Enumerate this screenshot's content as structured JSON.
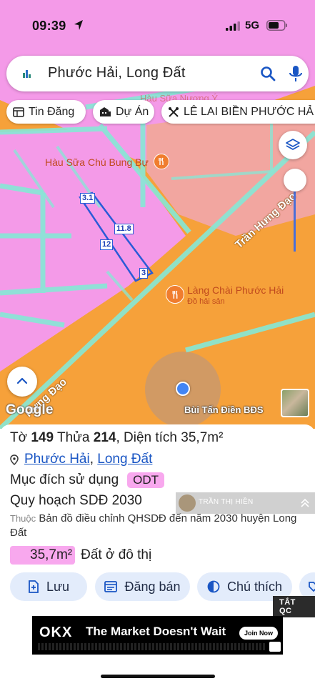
{
  "status_bar": {
    "time": "09:39",
    "network": "5G"
  },
  "search": {
    "query": "Phước Hải, Long Đất"
  },
  "chips": [
    {
      "label": "Tin Đăng",
      "icon": "newspaper-icon"
    },
    {
      "label": "Dự Án",
      "icon": "buildings-icon"
    },
    {
      "label": "LÊ LAI BIỀN PHƯỚC HẢ",
      "icon": "tools-icon"
    }
  ],
  "map": {
    "pois": [
      {
        "name": "Hàu Sữa Chú Bung Bự",
        "icon": "restaurant-icon"
      },
      {
        "name": "Làng Chài Phước Hải",
        "subtitle": "Đồ hải sản",
        "icon": "restaurant-icon"
      }
    ],
    "faded_poi": "Hàu Sữa Nương Ý",
    "streets": [
      "Trần Hưng Đạo",
      "Hưng Đạo"
    ],
    "dimensions": [
      "3.1",
      "11.8",
      "12",
      "3"
    ],
    "attribution": "Google",
    "owner_name": "Bùi Tấn Điền BĐS",
    "colors": {
      "urban_land": "#f6a13a",
      "residential": "#f49ae8",
      "road": "#86e8d6"
    }
  },
  "parcel": {
    "sheet_label": "Tờ",
    "sheet_no": "149",
    "lot_label": "Thửa",
    "lot_no": "214",
    "area_label": "Diện tích",
    "area": "35,7m²",
    "ward": "Phước Hải",
    "district": "Long Đất",
    "purpose_label": "Mục đích sử dụng",
    "purpose_code": "ODT",
    "plan_label": "Quy hoạch SDĐ 2030",
    "belongs_label": "Thuộc",
    "plan_note": "Bản đồ điều chỉnh QHSDĐ đến năm 2030 huyện Long Đất",
    "area_value": "35,7m²",
    "area_type": "Đất ở đô thị"
  },
  "overlay_card": {
    "name": "TRẦN THỊ HIỀN"
  },
  "actions": [
    {
      "label": "Lưu",
      "icon": "bookmark-add-icon"
    },
    {
      "label": "Đăng bán",
      "icon": "listing-icon"
    },
    {
      "label": "Chú thích",
      "icon": "legend-icon"
    }
  ],
  "ads": {
    "close_label": "TẮT QC",
    "brand": "OKX",
    "tagline": "The Market Doesn't Wait",
    "cta": "Join Now"
  }
}
